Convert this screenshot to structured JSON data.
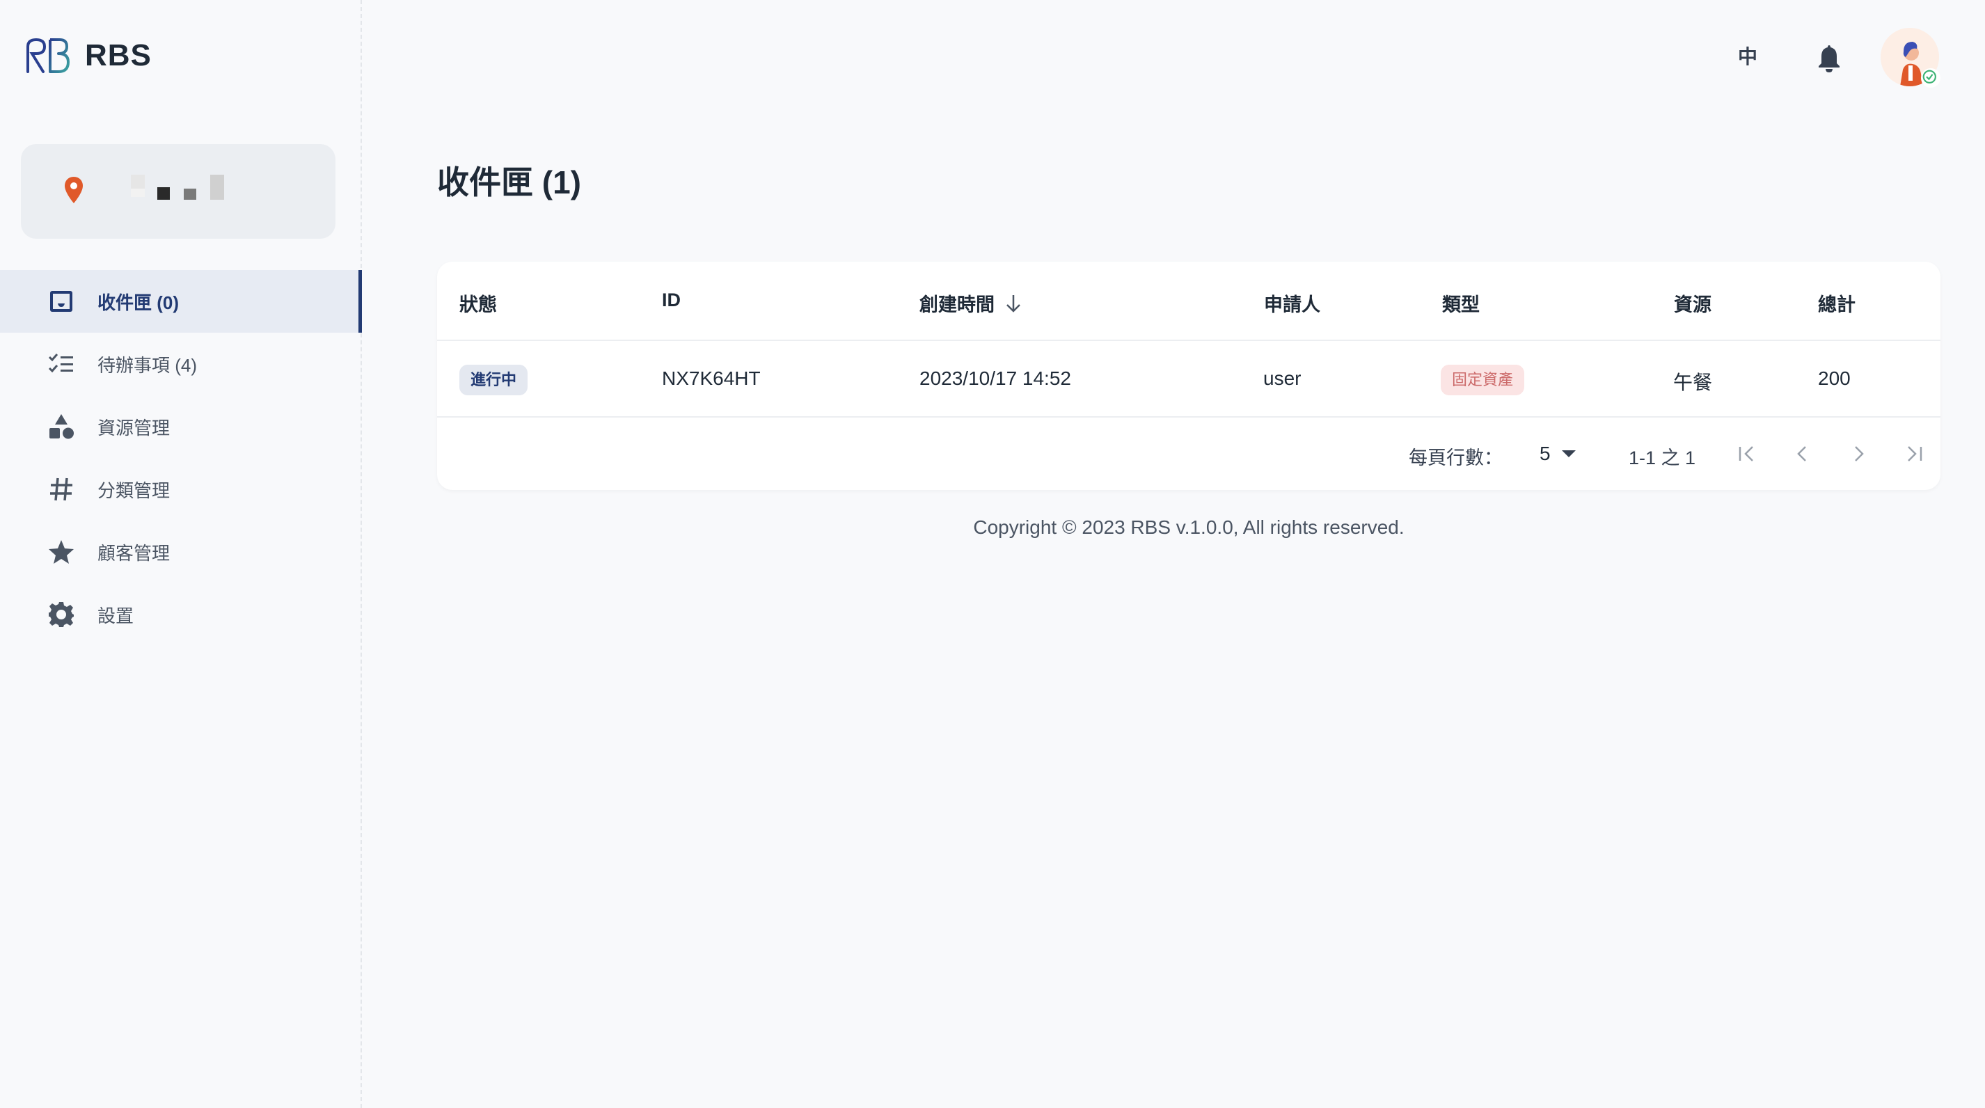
{
  "brand": {
    "name": "RBS",
    "logo_icon": "rb-logo-icon"
  },
  "location": {
    "icon": "map-pin-icon"
  },
  "sidebar": {
    "items": [
      {
        "label": "收件匣 (0)",
        "icon": "inbox-icon",
        "active": true
      },
      {
        "label": "待辦事項 (4)",
        "icon": "checklist-icon",
        "active": false
      },
      {
        "label": "資源管理",
        "icon": "shapes-icon",
        "active": false
      },
      {
        "label": "分類管理",
        "icon": "hash-icon",
        "active": false
      },
      {
        "label": "顧客管理",
        "icon": "star-icon",
        "active": false
      },
      {
        "label": "設置",
        "icon": "gear-icon",
        "active": false
      }
    ]
  },
  "header": {
    "language": "中",
    "notification_icon": "bell-icon",
    "avatar_icon": "user-avatar"
  },
  "main": {
    "title": "收件匣 (1)",
    "table": {
      "columns": [
        "狀態",
        "ID",
        "創建時間",
        "申請人",
        "類型",
        "資源",
        "總計"
      ],
      "rows": [
        {
          "status": "進行中",
          "id": "NX7K64HT",
          "created": "2023/10/17 14:52",
          "applicant": "user",
          "type": "固定資產",
          "resource": "午餐",
          "total": "200"
        }
      ]
    },
    "pagination": {
      "rows_per_page_label": "每頁行數：",
      "rows_per_page": "5",
      "range": "1-1 之 1"
    }
  },
  "footer": {
    "copyright": "Copyright © 2023 RBS v.1.0.0, All rights reserved."
  },
  "colors": {
    "accent": "#223a73",
    "status_chip_bg": "#e4e8f0",
    "type_chip_bg": "#fbe4e4",
    "type_chip_text": "#cc6a6a",
    "pin": "#e0592a"
  }
}
